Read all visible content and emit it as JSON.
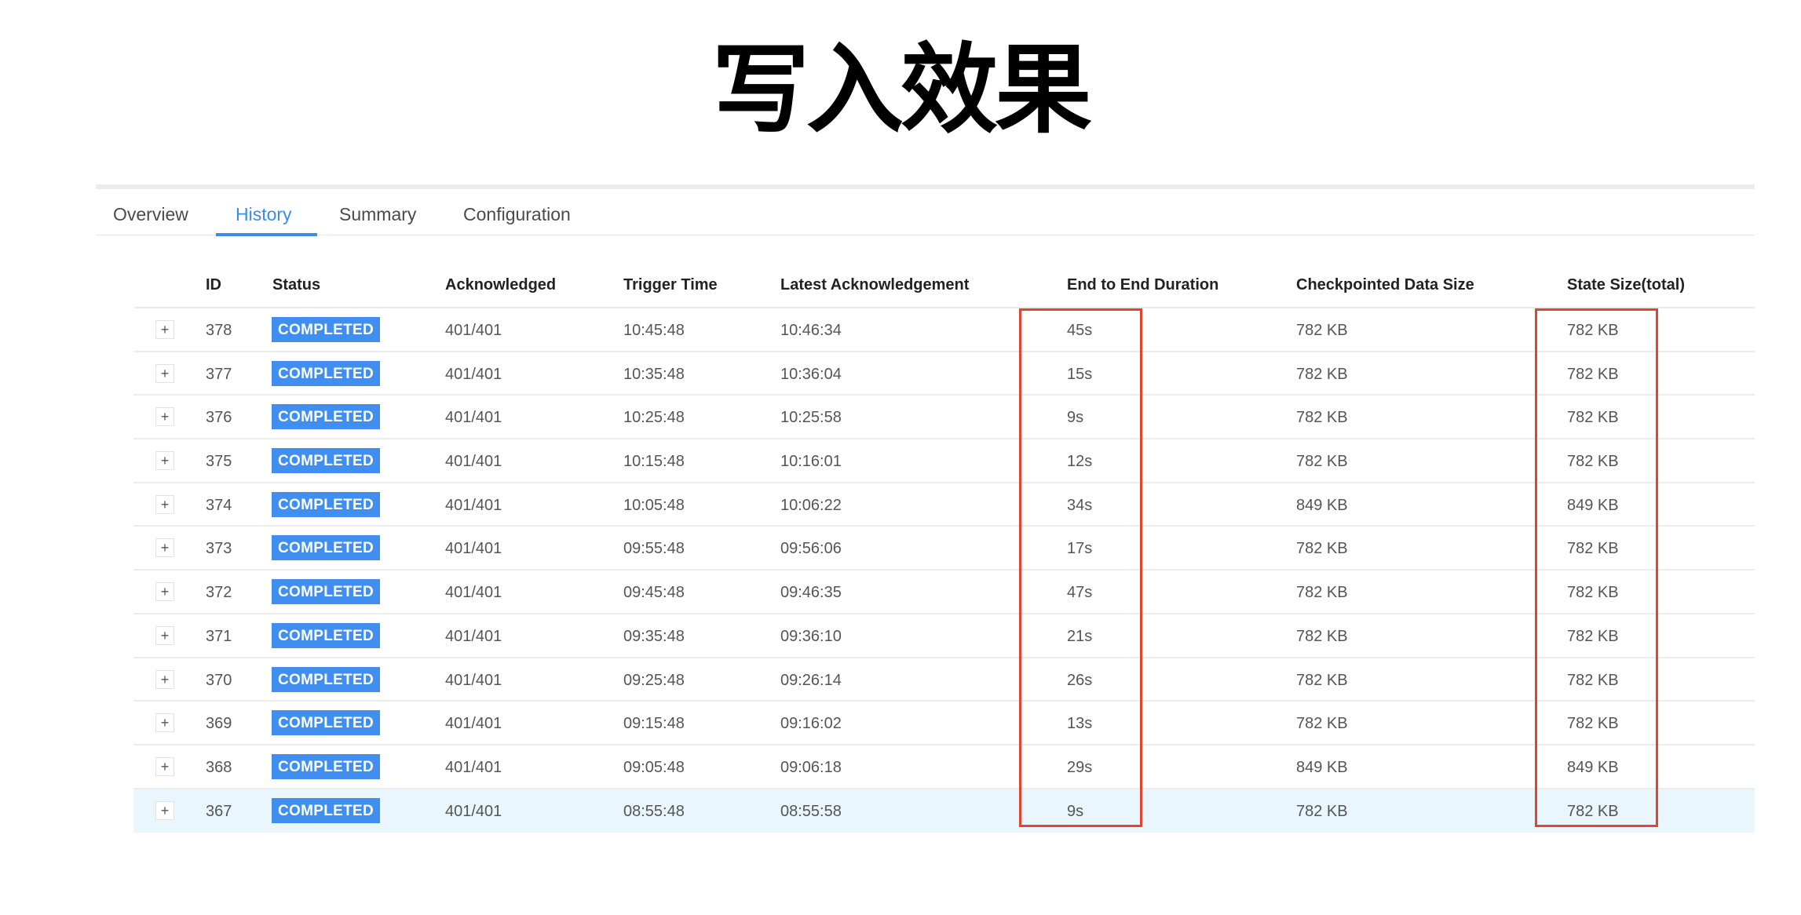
{
  "title": "写入效果",
  "tabs": [
    {
      "label": "Overview",
      "active": false
    },
    {
      "label": "History",
      "active": true
    },
    {
      "label": "Summary",
      "active": false
    },
    {
      "label": "Configuration",
      "active": false
    }
  ],
  "table": {
    "columns": [
      "ID",
      "Status",
      "Acknowledged",
      "Trigger Time",
      "Latest Acknowledgement",
      "End to End Duration",
      "Checkpointed Data Size",
      "State Size(total)"
    ],
    "expand_symbol": "+",
    "highlight_color": "#e9f6fd",
    "badge_color": "#3f8ef0",
    "annotation_color": "#e0452f",
    "highlighted_columns": [
      "End to End Duration",
      "State Size(total)"
    ],
    "rows": [
      {
        "id": "378",
        "status": "COMPLETED",
        "acknowledged": "401/401",
        "trigger_time": "10:45:48",
        "latest_ack": "10:46:34",
        "e2e": "45s",
        "data_size": "782 KB",
        "state_size": "782 KB"
      },
      {
        "id": "377",
        "status": "COMPLETED",
        "acknowledged": "401/401",
        "trigger_time": "10:35:48",
        "latest_ack": "10:36:04",
        "e2e": "15s",
        "data_size": "782 KB",
        "state_size": "782 KB"
      },
      {
        "id": "376",
        "status": "COMPLETED",
        "acknowledged": "401/401",
        "trigger_time": "10:25:48",
        "latest_ack": "10:25:58",
        "e2e": "9s",
        "data_size": "782 KB",
        "state_size": "782 KB"
      },
      {
        "id": "375",
        "status": "COMPLETED",
        "acknowledged": "401/401",
        "trigger_time": "10:15:48",
        "latest_ack": "10:16:01",
        "e2e": "12s",
        "data_size": "782 KB",
        "state_size": "782 KB"
      },
      {
        "id": "374",
        "status": "COMPLETED",
        "acknowledged": "401/401",
        "trigger_time": "10:05:48",
        "latest_ack": "10:06:22",
        "e2e": "34s",
        "data_size": "849 KB",
        "state_size": "849 KB"
      },
      {
        "id": "373",
        "status": "COMPLETED",
        "acknowledged": "401/401",
        "trigger_time": "09:55:48",
        "latest_ack": "09:56:06",
        "e2e": "17s",
        "data_size": "782 KB",
        "state_size": "782 KB"
      },
      {
        "id": "372",
        "status": "COMPLETED",
        "acknowledged": "401/401",
        "trigger_time": "09:45:48",
        "latest_ack": "09:46:35",
        "e2e": "47s",
        "data_size": "782 KB",
        "state_size": "782 KB"
      },
      {
        "id": "371",
        "status": "COMPLETED",
        "acknowledged": "401/401",
        "trigger_time": "09:35:48",
        "latest_ack": "09:36:10",
        "e2e": "21s",
        "data_size": "782 KB",
        "state_size": "782 KB"
      },
      {
        "id": "370",
        "status": "COMPLETED",
        "acknowledged": "401/401",
        "trigger_time": "09:25:48",
        "latest_ack": "09:26:14",
        "e2e": "26s",
        "data_size": "782 KB",
        "state_size": "782 KB"
      },
      {
        "id": "369",
        "status": "COMPLETED",
        "acknowledged": "401/401",
        "trigger_time": "09:15:48",
        "latest_ack": "09:16:02",
        "e2e": "13s",
        "data_size": "782 KB",
        "state_size": "782 KB"
      },
      {
        "id": "368",
        "status": "COMPLETED",
        "acknowledged": "401/401",
        "trigger_time": "09:05:48",
        "latest_ack": "09:06:18",
        "e2e": "29s",
        "data_size": "849 KB",
        "state_size": "849 KB"
      },
      {
        "id": "367",
        "status": "COMPLETED",
        "acknowledged": "401/401",
        "trigger_time": "08:55:48",
        "latest_ack": "08:55:58",
        "e2e": "9s",
        "data_size": "782 KB",
        "state_size": "782 KB",
        "highlighted": true
      }
    ]
  }
}
